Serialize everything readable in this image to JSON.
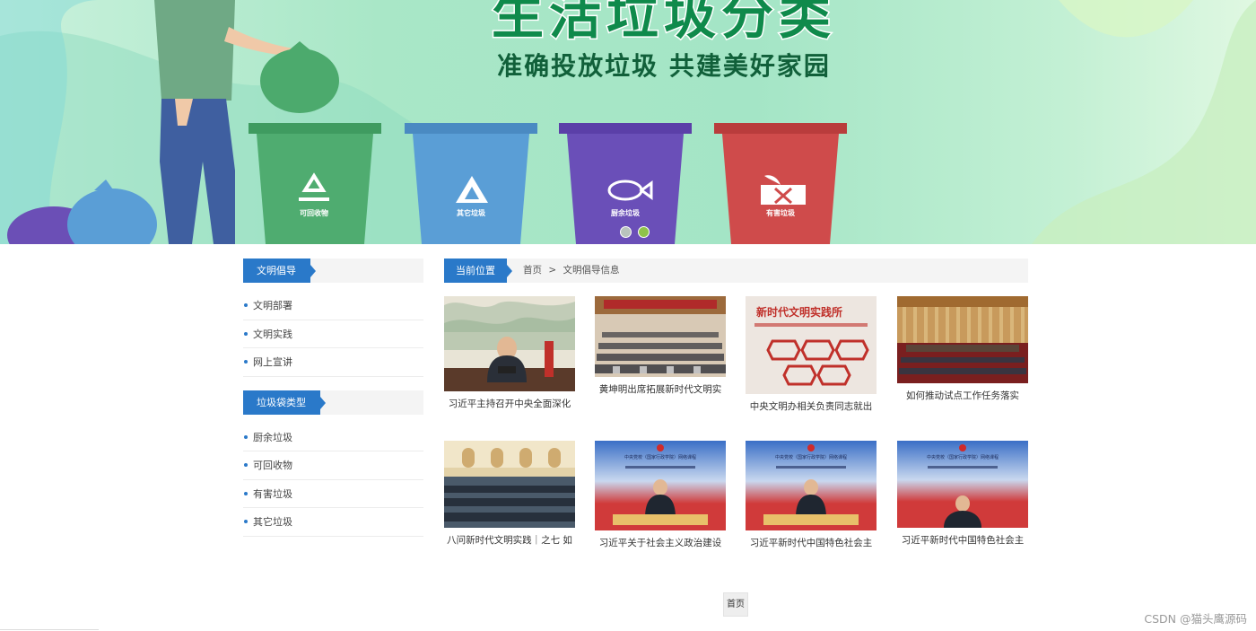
{
  "banner": {
    "title": "生活垃圾分类",
    "subtitle": "准确投放垃圾 共建美好家园",
    "bins": [
      {
        "label": "可回收物",
        "color": "#4fac70",
        "icon": "recycle-icon"
      },
      {
        "label": "其它垃圾",
        "color": "#5a9ed6",
        "icon": "triangle-waste-icon"
      },
      {
        "label": "厨余垃圾",
        "color": "#6a4fb8",
        "icon": "fish-bone-icon"
      },
      {
        "label": "有害垃圾",
        "color": "#cf4b4b",
        "icon": "hazard-battery-icon"
      }
    ],
    "slide_count": 2,
    "active_slide": 2
  },
  "sidebar": {
    "sections": [
      {
        "title": "文明倡导",
        "items": [
          "文明部署",
          "文明实践",
          "网上宣讲"
        ]
      },
      {
        "title": "垃圾袋类型",
        "items": [
          "厨余垃圾",
          "可回收物",
          "有害垃圾",
          "其它垃圾"
        ]
      }
    ]
  },
  "breadcrumb": {
    "label": "当前位置",
    "home": "首页",
    "separator": ">",
    "current": "文明倡导信息"
  },
  "articles": [
    {
      "title": "习近平主持召开中央全面深化"
    },
    {
      "title": "黄坤明出席拓展新时代文明实"
    },
    {
      "title": "中央文明办相关负责同志就出"
    },
    {
      "title": "如何推动试点工作任务落实"
    },
    {
      "title": "八问新时代文明实践｜之七 如"
    },
    {
      "title": "习近平关于社会主义政治建设"
    },
    {
      "title": "习近平新时代中国特色社会主"
    },
    {
      "title": "习近平新时代中国特色社会主"
    }
  ],
  "images": {
    "photo3_sign": "新时代文明实践所",
    "broadcast_banner": "中央党校（国家行政学院）网络课程"
  },
  "pagination": {
    "label": "首页"
  },
  "watermark": "CSDN @猫头鹰源码"
}
